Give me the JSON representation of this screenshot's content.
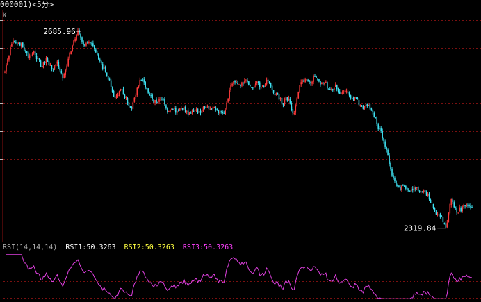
{
  "window": {
    "title": "000001)<5分>",
    "panel_label": "K"
  },
  "colors": {
    "background": "#000000",
    "up_candle": "#ff3b3b",
    "down_candle": "#3ee0f0",
    "grid": "#7a1010",
    "axis": "#8a1010",
    "rsi_line": "#e040e0",
    "rsi_label": "#b0b0b0",
    "rsi1": "#ffffff",
    "rsi2": "#ffff40",
    "rsi3": "#ff40ff"
  },
  "chart_data": [
    {
      "type": "candlestick",
      "interval": "5分",
      "annotations": [
        {
          "label": "2685.96",
          "kind": "max",
          "value": 2685.96
        },
        {
          "label": "2319.84",
          "kind": "min",
          "value": 2319.84
        }
      ],
      "ylim": [
        2300,
        2700
      ],
      "grid": true,
      "path_points": [
        [
          0,
          2610
        ],
        [
          5,
          2665
        ],
        [
          12,
          2662
        ],
        [
          18,
          2640
        ],
        [
          22,
          2648
        ],
        [
          28,
          2622
        ],
        [
          32,
          2634
        ],
        [
          36,
          2615
        ],
        [
          40,
          2626
        ],
        [
          44,
          2598
        ],
        [
          48,
          2632
        ],
        [
          52,
          2662
        ],
        [
          56,
          2685.96
        ],
        [
          60,
          2660
        ],
        [
          64,
          2668
        ],
        [
          68,
          2655
        ],
        [
          72,
          2628
        ],
        [
          76,
          2614
        ],
        [
          80,
          2592
        ],
        [
          84,
          2560
        ],
        [
          88,
          2578
        ],
        [
          92,
          2563
        ],
        [
          96,
          2542
        ],
        [
          100,
          2572
        ],
        [
          104,
          2598
        ],
        [
          108,
          2578
        ],
        [
          112,
          2560
        ],
        [
          116,
          2552
        ],
        [
          120,
          2562
        ],
        [
          124,
          2535
        ],
        [
          128,
          2542
        ],
        [
          132,
          2536
        ],
        [
          136,
          2545
        ],
        [
          140,
          2530
        ],
        [
          144,
          2540
        ],
        [
          148,
          2533
        ],
        [
          152,
          2548
        ],
        [
          156,
          2540
        ],
        [
          160,
          2544
        ],
        [
          164,
          2535
        ],
        [
          168,
          2538
        ],
        [
          172,
          2588
        ],
        [
          176,
          2592
        ],
        [
          180,
          2586
        ],
        [
          184,
          2596
        ],
        [
          188,
          2582
        ],
        [
          192,
          2590
        ],
        [
          196,
          2580
        ],
        [
          200,
          2594
        ],
        [
          204,
          2574
        ],
        [
          208,
          2566
        ],
        [
          212,
          2552
        ],
        [
          216,
          2564
        ],
        [
          220,
          2530
        ],
        [
          224,
          2580
        ],
        [
          228,
          2596
        ],
        [
          232,
          2588
        ],
        [
          236,
          2600
        ],
        [
          240,
          2586
        ],
        [
          244,
          2592
        ],
        [
          248,
          2572
        ],
        [
          252,
          2585
        ],
        [
          256,
          2570
        ],
        [
          260,
          2578
        ],
        [
          264,
          2565
        ],
        [
          268,
          2560
        ],
        [
          272,
          2545
        ],
        [
          276,
          2548
        ],
        [
          280,
          2542
        ],
        [
          284,
          2510
        ],
        [
          288,
          2490
        ],
        [
          292,
          2452
        ],
        [
          296,
          2412
        ],
        [
          300,
          2392
        ],
        [
          304,
          2396
        ],
        [
          308,
          2388
        ],
        [
          312,
          2396
        ],
        [
          316,
          2386
        ],
        [
          320,
          2392
        ],
        [
          324,
          2370
        ],
        [
          328,
          2350
        ],
        [
          332,
          2342
        ],
        [
          336,
          2319.84
        ],
        [
          340,
          2372
        ],
        [
          344,
          2352
        ],
        [
          348,
          2356
        ],
        [
          352,
          2366
        ],
        [
          356,
          2360
        ]
      ]
    },
    {
      "type": "line",
      "indicator": "RSI",
      "params_label": "RSI(14,14,14)",
      "series": [
        {
          "name": "RSI1",
          "label": "RSI1:",
          "value": 50.3263
        },
        {
          "name": "RSI2",
          "label": "RSI2:",
          "value": 50.3263
        },
        {
          "name": "RSI3",
          "label": "RSI3:",
          "value": 50.3263
        }
      ],
      "ylim": [
        30,
        70
      ]
    }
  ]
}
